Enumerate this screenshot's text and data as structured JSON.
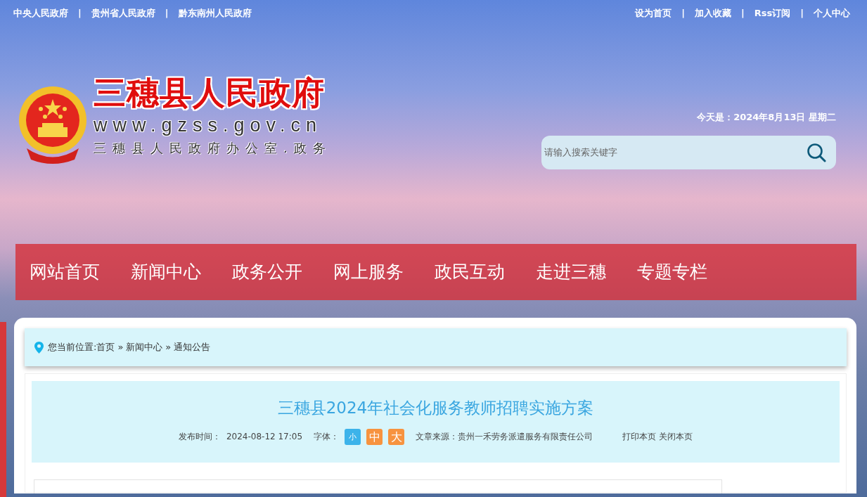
{
  "top_links": [
    "中央人民政府",
    "贵州省人民政府",
    "黔东南州人民政府"
  ],
  "top_separator": "|",
  "top_actions": [
    "设为首页",
    "加入收藏",
    "Rss订阅",
    "个人中心"
  ],
  "logo": {
    "title": "三穗县人民政府",
    "url": "www.gzss.gov.cn",
    "subtitle": "三穗县人民政府办公室.政务"
  },
  "date": "今天是：2024年8月13日 星期二",
  "search": {
    "placeholder": "请输入搜索关键字"
  },
  "nav": [
    {
      "label": "网站首页"
    },
    {
      "label": "新闻中心"
    },
    {
      "label": "政务公开"
    },
    {
      "label": "网上服务"
    },
    {
      "label": "政民互动"
    },
    {
      "label": "走进三穗"
    },
    {
      "label": "专题专栏"
    }
  ],
  "breadcrumb": {
    "prefix": "您当前位置:",
    "items": [
      "首页",
      "新闻中心",
      "通知公告"
    ],
    "separator": "»"
  },
  "article": {
    "title": "三穗县2024年社会化服务教师招聘实施方案",
    "publish_label": "发布时间：",
    "publish_time": "2024-08-12 17:05",
    "font_label": "字体：",
    "font_sizes": [
      {
        "label": "小",
        "selected": true
      },
      {
        "label": "中",
        "selected": false
      },
      {
        "label": "大",
        "selected": false
      }
    ],
    "source_label": "文章来源：",
    "source": "贵州一禾劳务派遣服务有限责任公司",
    "actions": [
      "打印本页",
      "关闭本页"
    ]
  }
}
